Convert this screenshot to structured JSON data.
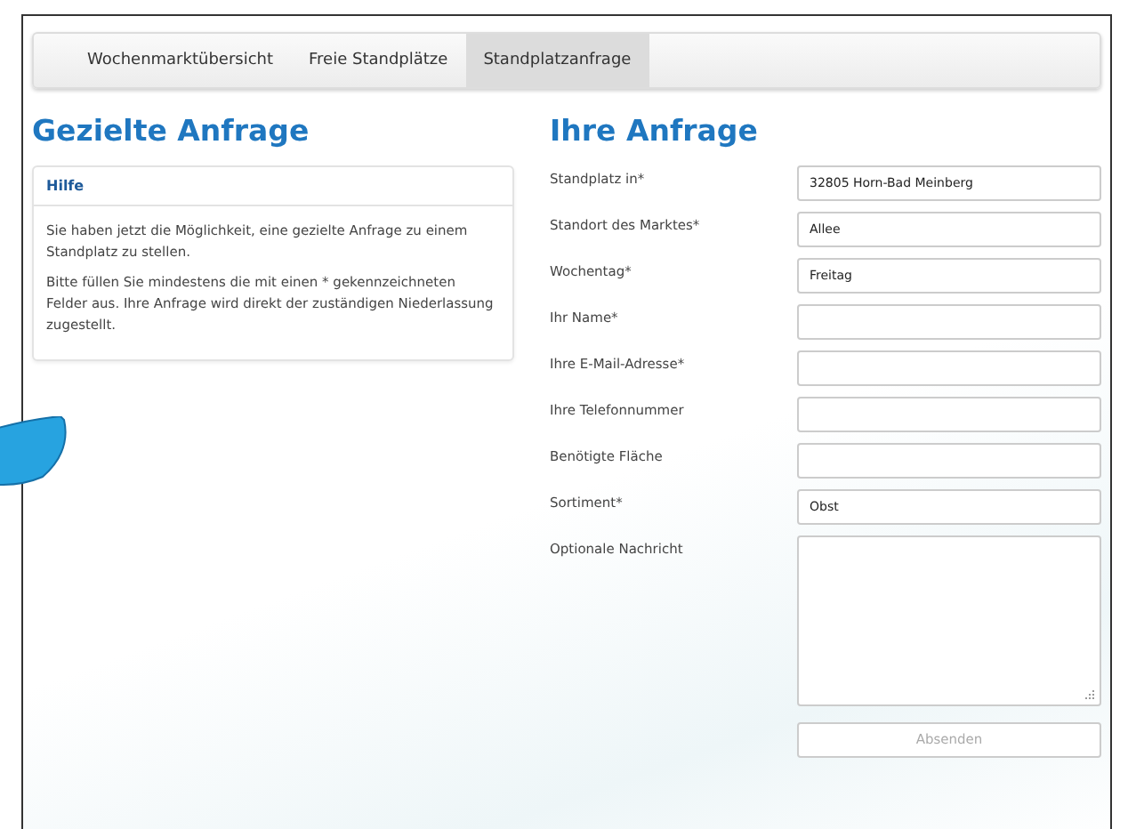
{
  "tabs": [
    {
      "label": "Wochenmarktübersicht",
      "selected": false
    },
    {
      "label": "Freie Standplätze",
      "selected": false
    },
    {
      "label": "Standplatzanfrage",
      "selected": true
    }
  ],
  "left": {
    "heading": "Gezielte Anfrage",
    "help": {
      "title": "Hilfe",
      "paragraphs": [
        "Sie haben jetzt die Möglichkeit, eine gezielte Anfrage zu einem Standplatz zu stellen.",
        "Bitte füllen Sie mindestens die mit einen * gekennzeichneten Felder aus. Ihre Anfrage wird direkt der zuständigen Niederlassung zugestellt."
      ]
    }
  },
  "form": {
    "heading": "Ihre Anfrage",
    "fields": [
      {
        "kind": "input",
        "label": "Standplatz in*",
        "value": "32805 Horn-Bad Meinberg"
      },
      {
        "kind": "input",
        "label": "Standort des Marktes*",
        "value": "Allee"
      },
      {
        "kind": "input",
        "label": "Wochentag*",
        "value": "Freitag"
      },
      {
        "kind": "input",
        "label": "Ihr Name*"
      },
      {
        "kind": "input",
        "label": "Ihre E-Mail-Adresse*"
      },
      {
        "kind": "input",
        "label": "Ihre Telefonnummer"
      },
      {
        "kind": "input",
        "label": "Benötigte Fläche"
      },
      {
        "kind": "input",
        "label": "Sortiment*",
        "value": "Obst"
      },
      {
        "kind": "textarea",
        "label": "Optionale Nachricht"
      }
    ],
    "submit": {
      "label": "Absenden",
      "disabled": true
    }
  }
}
